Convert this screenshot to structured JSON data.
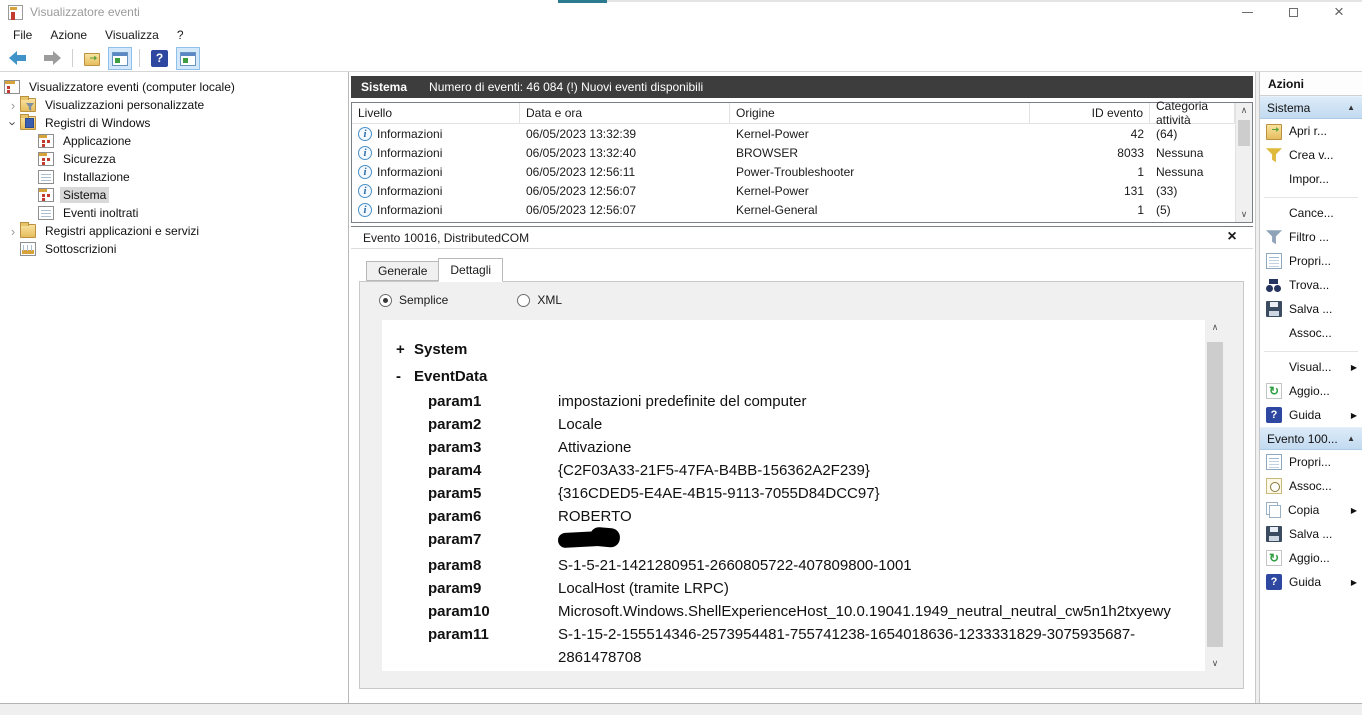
{
  "colors": {
    "list_titlebar_bg": "#3d3d3d",
    "group_header_blue": "#c9def2",
    "toolbar_toggle_blue": "#d3e9fb",
    "tree_selection_gray": "#d9d9d9",
    "redaction_black": "#000000"
  },
  "window": {
    "title": "Visualizzatore eventi"
  },
  "menu": {
    "items": [
      "File",
      "Azione",
      "Visualizza",
      "?"
    ]
  },
  "tree": {
    "items": [
      {
        "label": "Visualizzatore eventi (computer locale)"
      },
      {
        "label": "Visualizzazioni personalizzate"
      },
      {
        "label": "Registri di Windows"
      },
      {
        "label": "Applicazione"
      },
      {
        "label": "Sicurezza"
      },
      {
        "label": "Installazione"
      },
      {
        "label": "Sistema",
        "selected": true
      },
      {
        "label": "Eventi inoltrati"
      },
      {
        "label": "Registri applicazioni e servizi"
      },
      {
        "label": "Sottoscrizioni"
      }
    ]
  },
  "list_header": {
    "title": "Sistema",
    "subtitle": "Numero di eventi: 46 084 (!) Nuovi eventi disponibili"
  },
  "event_table": {
    "columns": [
      "Livello",
      "Data e ora",
      "Origine",
      "ID evento",
      "Categoria attività"
    ],
    "rows": [
      {
        "level": "Informazioni",
        "datetime": "06/05/2023 13:32:39",
        "source": "Kernel-Power",
        "id": "42",
        "category": "(64)"
      },
      {
        "level": "Informazioni",
        "datetime": "06/05/2023 13:32:40",
        "source": "BROWSER",
        "id": "8033",
        "category": "Nessuna"
      },
      {
        "level": "Informazioni",
        "datetime": "06/05/2023 12:56:11",
        "source": "Power-Troubleshooter",
        "id": "1",
        "category": "Nessuna"
      },
      {
        "level": "Informazioni",
        "datetime": "06/05/2023 12:56:07",
        "source": "Kernel-Power",
        "id": "131",
        "category": "(33)"
      },
      {
        "level": "Informazioni",
        "datetime": "06/05/2023 12:56:07",
        "source": "Kernel-General",
        "id": "1",
        "category": "(5)"
      }
    ]
  },
  "detail": {
    "title": "Evento 10016, DistributedCOM",
    "tabs": [
      "Generale",
      "Dettagli"
    ],
    "active_tab": "Dettagli",
    "radio": {
      "options": [
        "Semplice",
        "XML"
      ],
      "selected": "Semplice"
    },
    "nodes": [
      {
        "sign": "+",
        "label": "System"
      },
      {
        "sign": "-",
        "label": "EventData"
      }
    ],
    "params": [
      {
        "name": "param1",
        "value": "impostazioni predefinite del computer"
      },
      {
        "name": "param2",
        "value": "Locale"
      },
      {
        "name": "param3",
        "value": "Attivazione"
      },
      {
        "name": "param4",
        "value": "{C2F03A33-21F5-47FA-B4BB-156362A2F239}"
      },
      {
        "name": "param5",
        "value": "{316CDED5-E4AE-4B15-9113-7055D84DCC97}"
      },
      {
        "name": "param6",
        "value": "ROBERTO"
      },
      {
        "name": "param7",
        "value": "",
        "redacted": true
      },
      {
        "name": "param8",
        "value": "S-1-5-21-1421280951-2660805722-407809800-1001"
      },
      {
        "name": "param9",
        "value": "LocalHost (tramite LRPC)"
      },
      {
        "name": "param10",
        "value": "Microsoft.Windows.ShellExperienceHost_10.0.19041.1949_neutral_neutral_cw5n1h2txyewy"
      },
      {
        "name": "param11",
        "value": "S-1-15-2-155514346-2573954481-755741238-1654018636-1233331829-3075935687-2861478708"
      }
    ]
  },
  "actions": {
    "title": "Azioni",
    "groups": [
      {
        "header": "Sistema",
        "items": [
          {
            "label": "Apri r..."
          },
          {
            "label": "Crea v..."
          },
          {
            "label": "Impor..."
          },
          {
            "label": "Cance..."
          },
          {
            "label": "Filtro ..."
          },
          {
            "label": "Propri..."
          },
          {
            "label": "Trova..."
          },
          {
            "label": "Salva ..."
          },
          {
            "label": "Assoc..."
          },
          {
            "label": "Visual..."
          },
          {
            "label": "Aggio..."
          },
          {
            "label": "Guida"
          }
        ]
      },
      {
        "header": "Evento 100...",
        "items": [
          {
            "label": "Propri..."
          },
          {
            "label": "Assoc..."
          },
          {
            "label": "Copia"
          },
          {
            "label": "Salva ..."
          },
          {
            "label": "Aggio..."
          },
          {
            "label": "Guida"
          }
        ]
      }
    ]
  }
}
